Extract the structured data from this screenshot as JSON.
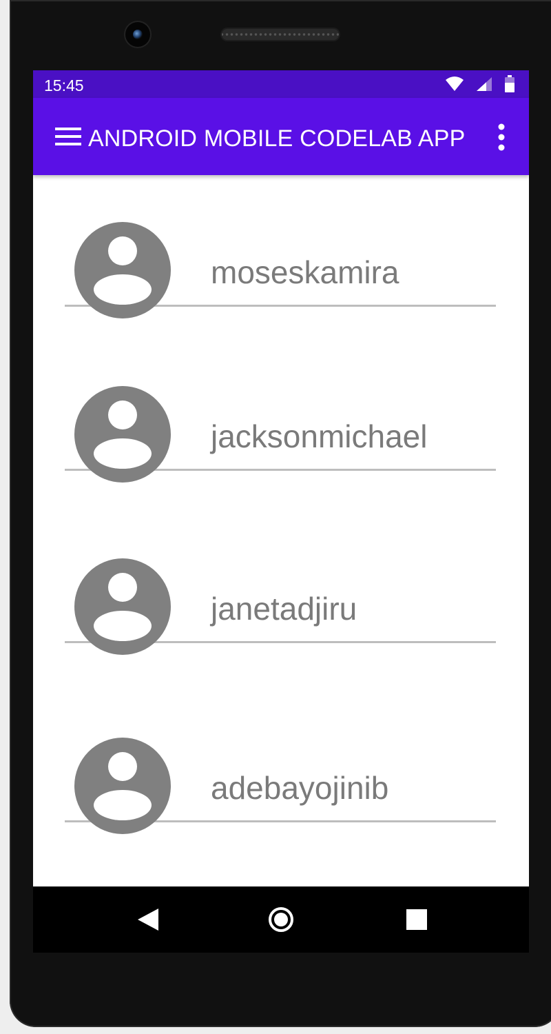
{
  "status_bar": {
    "time": "15:45",
    "icons": [
      "wifi-icon",
      "signal-icon",
      "battery-icon"
    ]
  },
  "app_bar": {
    "title": "ANDROID MOBILE CODELAB APP",
    "menu_icon": "hamburger-menu-icon",
    "overflow_icon": "more-vert-icon"
  },
  "users": [
    {
      "username": "moseskamira",
      "avatar_icon": "account-circle-icon"
    },
    {
      "username": "jacksonmichael",
      "avatar_icon": "account-circle-icon"
    },
    {
      "username": "janetadjiru",
      "avatar_icon": "account-circle-icon"
    },
    {
      "username": "adebayojinib",
      "avatar_icon": "account-circle-icon"
    }
  ],
  "nav_bar": {
    "back_icon": "back-triangle-icon",
    "home_icon": "home-circle-icon",
    "recents_icon": "recents-square-icon"
  },
  "colors": {
    "status_bar": "#4a10c4",
    "app_bar": "#5a10e6",
    "avatar": "#808080",
    "divider": "#bdbdbd",
    "username_text": "#7a7a7a"
  }
}
